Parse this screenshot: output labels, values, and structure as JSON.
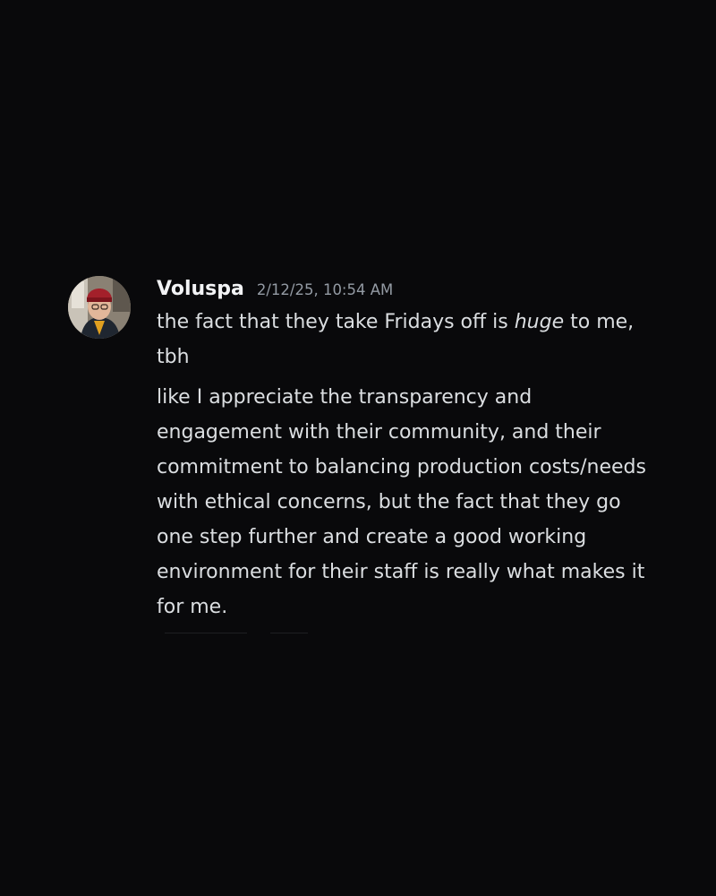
{
  "message": {
    "author": "Voluspa",
    "timestamp": "2/12/25, 10:54 AM",
    "lines": [
      {
        "before": "the fact that they take Fridays off is ",
        "emphasis": "huge",
        "after": " to me, tbh"
      },
      {
        "text": "like I appreciate the transparency and engagement with their community, and their commitment to balancing production costs/needs with ethical concerns, but the fact that they go one step further and create a good working environment for their staff is really what makes it for me."
      }
    ]
  },
  "colors": {
    "background": "#09090b",
    "username": "#f2f3f5",
    "timestamp": "#949ba4",
    "message_text": "#dbdee1"
  },
  "icons": {
    "avatar": "user-avatar-photo"
  }
}
